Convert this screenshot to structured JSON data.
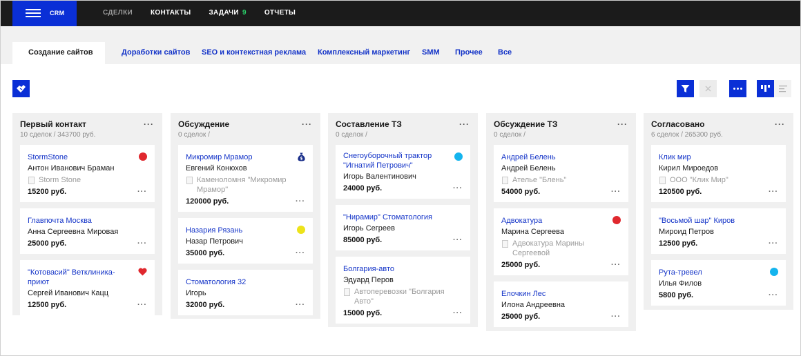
{
  "app": {
    "brand": "CRM"
  },
  "topnav": {
    "items": [
      {
        "label": "СДЕЛКИ",
        "muted": true
      },
      {
        "label": "КОНТАКТЫ",
        "muted": false
      },
      {
        "label": "ЗАДАЧИ",
        "muted": false,
        "badge": "9"
      },
      {
        "label": "ОТЧЕТЫ",
        "muted": false
      }
    ]
  },
  "tabs": {
    "active": "Создание сайтов",
    "items": [
      "Доработки сайтов",
      "SEO и контекстная реклама",
      "Комплексный маркетинг",
      "SMM",
      "Прочее",
      "Все"
    ]
  },
  "colors": {
    "accent": "#0a2fd6",
    "link": "#1434c8",
    "red": "#e0282e",
    "yellow": "#ede31a",
    "cyan": "#14b4ee",
    "heart": "#e0282e",
    "bag": "#1a2f8a"
  },
  "columns": [
    {
      "title": "Первый контакт",
      "subtitle": "10 сделок / 343700 руб.",
      "cards": [
        {
          "title": "StormStone",
          "person": "Антон Иванович Браман",
          "company": "Storm Stone",
          "sum": "15200 руб.",
          "marker": "red-dot"
        },
        {
          "title": "Главпочта Москва",
          "person": "Анна Сергеевна Мировая",
          "company": "",
          "sum": "25000 руб.",
          "marker": ""
        },
        {
          "title": "\"Котовасий\" Ветклиника-приют",
          "person": "Сергей Иванович Кацц",
          "company": "",
          "sum": "12500 руб.",
          "marker": "heart-icon"
        }
      ]
    },
    {
      "title": "Обсуждение",
      "subtitle": "0 сделок /",
      "cards": [
        {
          "title": "Микромир Мрамор",
          "person": "Евгений Конюхов",
          "company": "Каменоломня \"Микромир Мрамор\"",
          "sum": "120000 руб.",
          "marker": "money-bag-icon"
        },
        {
          "title": "Назария Рязань",
          "person": "Назар Петрович",
          "company": "",
          "sum": "35000 руб.",
          "marker": "yellow-dot"
        },
        {
          "title": "Стоматология 32",
          "person": "Игорь",
          "company": "",
          "sum": "32000 руб.",
          "marker": ""
        }
      ]
    },
    {
      "title": "Составление ТЗ",
      "subtitle": "0 сделок /",
      "cards": [
        {
          "title": "Снегоуборочный трактор \"Игнатий Петрович\"",
          "person": "Игорь Валентинович",
          "company": "",
          "sum": "24000 руб.",
          "marker": "cyan-dot"
        },
        {
          "title": "\"Нирамир\" Стоматология",
          "person": "Игорь Сегреев",
          "company": "",
          "sum": "85000 руб.",
          "marker": ""
        },
        {
          "title": "Болгария-авто",
          "person": "Эдуард Перов",
          "company": "Автоперевозки \"Болгария Авто\"",
          "sum": "15000 руб.",
          "marker": ""
        }
      ]
    },
    {
      "title": "Обсуждение ТЗ",
      "subtitle": "0 сделок /",
      "cards": [
        {
          "title": "Андрей Белень",
          "person": "Андрей Белень",
          "company": "Ателье \"Блень\"",
          "sum": "54000 руб.",
          "marker": ""
        },
        {
          "title": "Адвокатура",
          "person": "Марина Сергеева",
          "company": "Адвокатура Марины Сергеевой",
          "sum": "25000 руб.",
          "marker": "red-dot"
        },
        {
          "title": "Елочкин Лес",
          "person": "Илона Андреевна",
          "company": "",
          "sum": "25000 руб.",
          "marker": ""
        }
      ]
    },
    {
      "title": "Согласовано",
      "subtitle": "6 сделок / 265300 руб.",
      "cards": [
        {
          "title": "Клик мир",
          "person": "Кирил Мироедов",
          "company": "ООО \"Клик Мир\"",
          "sum": "120500 руб.",
          "marker": ""
        },
        {
          "title": "\"Восьмой шар\" Киров",
          "person": "Мироид Петров",
          "company": "",
          "sum": "12500 руб.",
          "marker": ""
        },
        {
          "title": "Рута-тревел",
          "person": "Илья Филов",
          "company": "",
          "sum": "5800 руб.",
          "marker": "cyan-dot"
        }
      ]
    }
  ]
}
